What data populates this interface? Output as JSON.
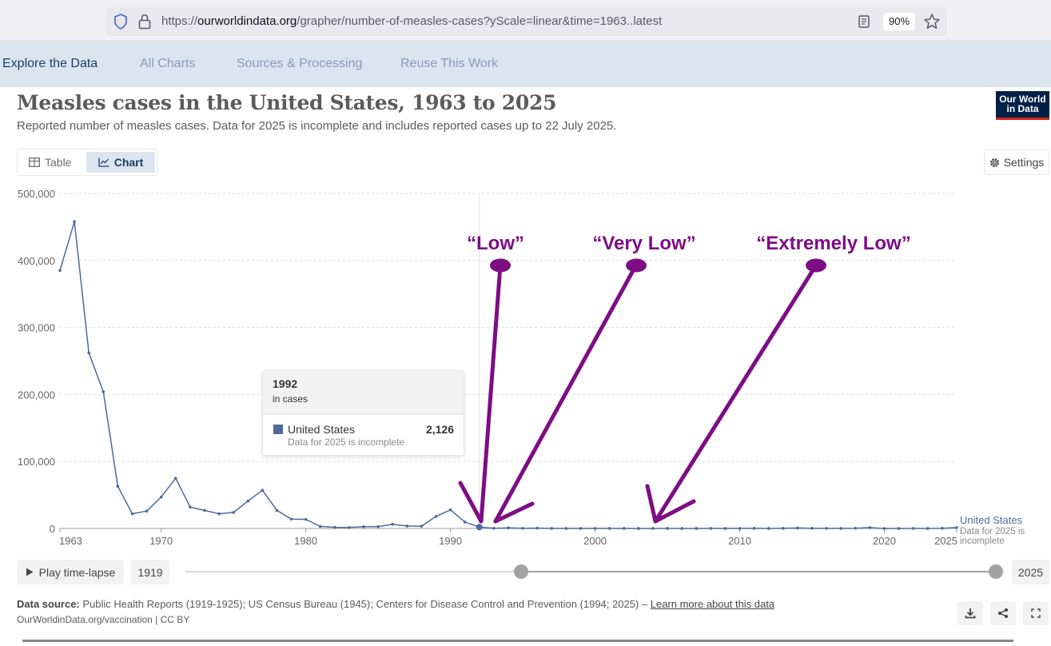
{
  "browser": {
    "url_prefix": "https://",
    "url_domain": "ourworldindata.org",
    "url_path": "/grapher/number-of-measles-cases?yScale=linear&time=1963..latest",
    "zoom": "90%"
  },
  "nav": {
    "tabs": [
      {
        "label": "Explore the Data"
      },
      {
        "label": "All Charts"
      },
      {
        "label": "Sources & Processing"
      },
      {
        "label": "Reuse This Work"
      }
    ]
  },
  "header": {
    "title": "Measles cases in the United States, 1963 to 2025",
    "subtitle": "Reported number of measles cases. Data for 2025 is incomplete and includes reported cases up to 22 July 2025.",
    "logo_line1": "Our World",
    "logo_line2": "in Data"
  },
  "controls": {
    "table_label": "Table",
    "chart_label": "Chart",
    "settings_label": "Settings"
  },
  "tooltip": {
    "year": "1992",
    "unit": "in cases",
    "entity": "United States",
    "value": "2,126",
    "note": "Data for 2025 is incomplete"
  },
  "timeline": {
    "play_label": "Play time-lapse",
    "start_year": "1919",
    "end_year": "2025",
    "range_start_frac": 0.41,
    "range_end_frac": 0.99
  },
  "footer": {
    "source_label": "Data source:",
    "source_text": "Public Health Reports (1919-1925); US Census Bureau (1945); Centers for Disease Control and Prevention (1994; 2025) –",
    "source_link": "Learn more about this data",
    "license": "OurWorldinData.org/vaccination | CC BY"
  },
  "colors": {
    "series": "#4c6a9c",
    "annotation": "#7d0d85",
    "nav_bg": "#dbe5f0"
  },
  "chart_data": {
    "type": "line",
    "xlim": [
      1963,
      2025
    ],
    "ylim": [
      0,
      500000
    ],
    "y_ticks": [
      0,
      100000,
      200000,
      300000,
      400000,
      500000
    ],
    "y_tick_labels": [
      "0",
      "100,000",
      "200,000",
      "300,000",
      "400,000",
      "500,000"
    ],
    "x_ticks": [
      1963,
      1970,
      1980,
      1990,
      2000,
      2010,
      2020,
      2025
    ],
    "x_tick_labels": [
      "1963",
      "1970",
      "1980",
      "1990",
      "2000",
      "2010",
      "2020",
      "2025"
    ],
    "grid": "horizontal-dashed",
    "hover_year": 1992,
    "series": [
      {
        "name": "United States",
        "note": "Data for 2025 is",
        "note2": "incomplete",
        "x": [
          1963,
          1964,
          1965,
          1966,
          1967,
          1968,
          1969,
          1970,
          1971,
          1972,
          1973,
          1974,
          1975,
          1976,
          1977,
          1978,
          1979,
          1980,
          1981,
          1982,
          1983,
          1984,
          1985,
          1986,
          1987,
          1988,
          1989,
          1990,
          1991,
          1992,
          1993,
          1994,
          1995,
          1996,
          1997,
          1998,
          1999,
          2000,
          2001,
          2002,
          2003,
          2004,
          2005,
          2006,
          2007,
          2008,
          2009,
          2010,
          2011,
          2012,
          2013,
          2014,
          2015,
          2016,
          2017,
          2018,
          2019,
          2020,
          2021,
          2022,
          2023,
          2024,
          2025
        ],
        "values": [
          385000,
          458000,
          262000,
          204000,
          63000,
          22000,
          26000,
          47000,
          75000,
          32000,
          27000,
          22000,
          24000,
          41000,
          57000,
          27000,
          14000,
          13500,
          3100,
          1700,
          1500,
          2600,
          2800,
          6300,
          3700,
          3400,
          18000,
          27800,
          9600,
          2126,
          312,
          963,
          309,
          508,
          138,
          100,
          100,
          86,
          116,
          44,
          56,
          37,
          66,
          55,
          43,
          140,
          71,
          63,
          220,
          55,
          187,
          667,
          188,
          86,
          120,
          375,
          1274,
          13,
          49,
          121,
          59,
          285,
          1300
        ]
      }
    ],
    "annotations": [
      {
        "text": "“Low”"
      },
      {
        "text": "“Very Low”"
      },
      {
        "text": "“Extremely Low”"
      }
    ]
  }
}
